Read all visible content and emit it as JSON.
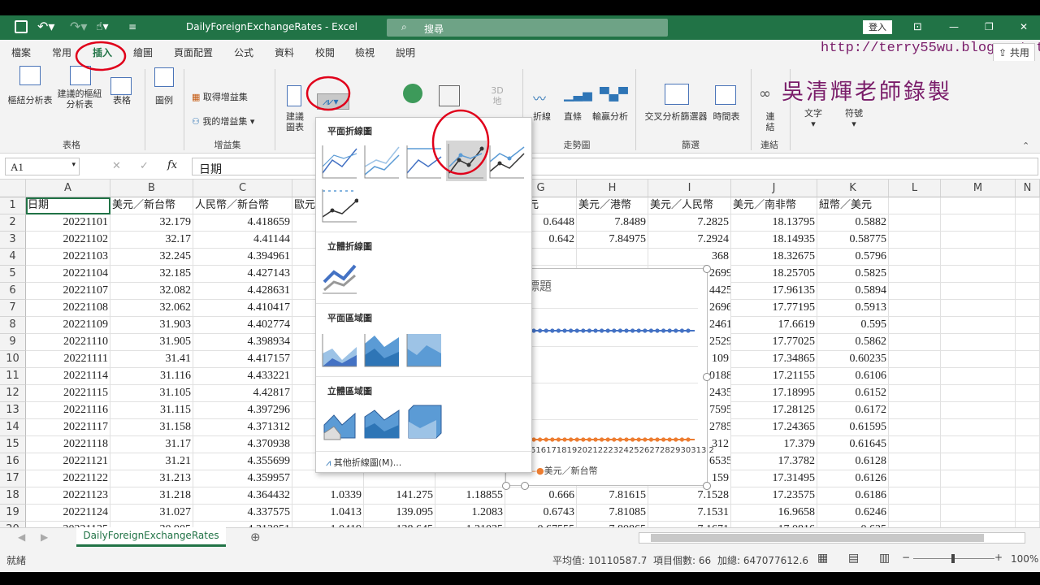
{
  "window": {
    "title": "DailyForeignExchangeRates - Excel",
    "search": "搜尋",
    "signin": "登入"
  },
  "menu": {
    "items": [
      "檔案",
      "常用",
      "插入",
      "繪圖",
      "頁面配置",
      "公式",
      "資料",
      "校閱",
      "檢視",
      "說明"
    ],
    "share": "共用"
  },
  "watermark": {
    "url": "http://terry55wu.blogspot.tw",
    "author": "吳清輝老師錄製"
  },
  "ribbon": {
    "pivot_table": "樞紐分析表",
    "recommended_pivot": "建議的樞紐分析表",
    "table": "表格",
    "group_tables": "表格",
    "illustrations": "圖例",
    "get_addins": "取得增益集",
    "my_addins": "我的增益集",
    "group_addins": "增益集",
    "recommended_charts": "建議圖表",
    "map": "地圖",
    "pivot_chart": "樞紐",
    "3d_map": "3D 地",
    "sparkline_line": "折線",
    "sparkline_column": "直條",
    "sparkline_winloss": "輸贏分析",
    "group_sparklines": "走勢圖",
    "slicer": "交叉分析篩選器",
    "timeline": "時間表",
    "group_filters": "篩選",
    "link": "連結",
    "group_links": "連結",
    "text": "文字",
    "symbols": "符號"
  },
  "formula_bar": {
    "name_box": "A1",
    "content": "日期",
    "fx": "fx"
  },
  "columns": [
    "A",
    "B",
    "C",
    "D",
    "E",
    "F",
    "G",
    "H",
    "I",
    "J",
    "K",
    "L",
    "M",
    "N"
  ],
  "header_row": [
    "日期",
    "美元／新台幣",
    "人民幣／新台幣",
    "歐元",
    "",
    "",
    "／美元",
    "美元／港幣",
    "美元／人民幣",
    "美元／南非幣",
    "紐幣／美元"
  ],
  "rows": [
    {
      "n": "2",
      "a": "20221101",
      "b": "32.179",
      "c": "4.418659",
      "g": "0.6448",
      "h": "7.8489",
      "i": "7.2825",
      "j": "18.13795",
      "k": "0.5882"
    },
    {
      "n": "3",
      "a": "20221102",
      "b": "32.17",
      "c": "4.41144",
      "g": "0.642",
      "h": "7.84975",
      "i": "7.2924",
      "j": "18.14935",
      "k": "0.58775"
    },
    {
      "n": "4",
      "a": "20221103",
      "b": "32.245",
      "c": "4.394961",
      "g": "",
      "h": "",
      "i": "",
      "j": "18.32675",
      "k": "0.5796"
    },
    {
      "n": "5",
      "a": "20221104",
      "b": "32.185",
      "c": "4.427143",
      "g": "",
      "h": "",
      "i": "",
      "j": "18.25705",
      "k": "0.5825"
    },
    {
      "n": "6",
      "a": "20221107",
      "b": "32.082",
      "c": "4.428631",
      "g": "",
      "h": "",
      "i": "",
      "j": "17.96135",
      "k": "0.5894"
    },
    {
      "n": "7",
      "a": "20221108",
      "b": "32.062",
      "c": "4.410417",
      "g": "",
      "h": "",
      "i": "",
      "j": "17.77195",
      "k": "0.5913"
    },
    {
      "n": "8",
      "a": "20221109",
      "b": "31.903",
      "c": "4.402774",
      "g": "",
      "h": "",
      "i": "",
      "j": "17.6619",
      "k": "0.595"
    },
    {
      "n": "9",
      "a": "20221110",
      "b": "31.905",
      "c": "4.398934",
      "g": "",
      "h": "",
      "i": "",
      "j": "17.77025",
      "k": "0.5862"
    },
    {
      "n": "10",
      "a": "20221111",
      "b": "31.41",
      "c": "4.417157",
      "g": "",
      "h": "",
      "i": "",
      "j": "17.34865",
      "k": "0.60235"
    },
    {
      "n": "11",
      "a": "20221114",
      "b": "31.116",
      "c": "4.433221",
      "g": "",
      "h": "",
      "i": "",
      "j": "17.21155",
      "k": "0.6106"
    },
    {
      "n": "12",
      "a": "20221115",
      "b": "31.105",
      "c": "4.42817",
      "g": "",
      "h": "",
      "i": "",
      "j": "17.18995",
      "k": "0.6152"
    },
    {
      "n": "13",
      "a": "20221116",
      "b": "31.115",
      "c": "4.397296",
      "g": "",
      "h": "",
      "i": "",
      "j": "17.28125",
      "k": "0.6172"
    },
    {
      "n": "14",
      "a": "20221117",
      "b": "31.158",
      "c": "4.371312",
      "g": "",
      "h": "",
      "i": "",
      "j": "17.24365",
      "k": "0.61595"
    },
    {
      "n": "15",
      "a": "20221118",
      "b": "31.17",
      "c": "4.370938",
      "g": "",
      "h": "",
      "i": "",
      "j": "17.379",
      "k": "0.61645"
    },
    {
      "n": "16",
      "a": "20221121",
      "b": "31.21",
      "c": "4.355699",
      "g": "",
      "h": "",
      "i": "",
      "j": "17.3782",
      "k": "0.6128"
    },
    {
      "n": "17",
      "a": "20221122",
      "b": "31.213",
      "c": "4.359957",
      "g": "",
      "h": "",
      "i": "",
      "j": "17.31495",
      "k": "0.6126"
    },
    {
      "n": "18",
      "a": "20221123",
      "b": "31.218",
      "c": "4.364432",
      "d": "1.0339",
      "e": "141.275",
      "f": "1.18855",
      "g": "0.666",
      "h": "7.81615",
      "i": "7.1528",
      "j": "17.23575",
      "k": "0.6186"
    },
    {
      "n": "19",
      "a": "20221124",
      "b": "31.027",
      "c": "4.337575",
      "d": "1.0413",
      "e": "139.095",
      "f": "1.2083",
      "g": "0.6743",
      "h": "7.81085",
      "i": "7.1531",
      "j": "16.9658",
      "k": "0.6246"
    },
    {
      "n": "20",
      "a": "20221125",
      "b": "30.905",
      "c": "4.312051",
      "d": "1.0419",
      "e": "138.645",
      "f": "1.21035",
      "g": "0.67555",
      "h": "7.80865",
      "i": "7.1671",
      "j": "17.0816",
      "k": "0.625"
    }
  ],
  "partial_col_i": [
    "",
    "",
    "368",
    "2699",
    "4425",
    "2696",
    "2461",
    "2529",
    "109",
    "0188",
    "2435",
    "7595",
    "2785",
    "312",
    "6535",
    "159"
  ],
  "partial_col_d17": "1.0",
  "chart_preview": {
    "title_fragment": "標題",
    "axis_labels": "5161718192021222324252627282930313 2",
    "legend": "美元／新台幣"
  },
  "dropdown": {
    "h2d_line": "平面折線圖",
    "h3d_line": "立體折線圖",
    "h2d_area": "平面區域圖",
    "h3d_area": "立體區域圖",
    "more": "其他折線圖(M)..."
  },
  "sheet": {
    "tab": "DailyForeignExchangeRates"
  },
  "status": {
    "ready": "就緒",
    "average": "平均值: 10110587.7",
    "count": "項目個數: 66",
    "sum": "加總: 647077612.6",
    "zoom": "100%"
  },
  "colors": {
    "excel_green": "#217346",
    "accent_red": "#e0001a"
  }
}
